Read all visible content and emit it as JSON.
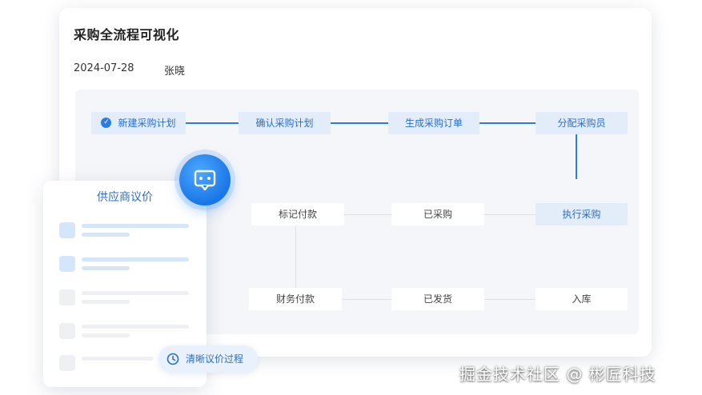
{
  "header": {
    "title": "采购全流程可视化",
    "date": "2024-07-28",
    "user": "张晓"
  },
  "flow": {
    "row1": [
      "新建采购计划",
      "确认采购计划",
      "生成采购订单",
      "分配采购员"
    ],
    "row2": [
      "标记付款",
      "已采购",
      "执行采购"
    ],
    "row3": [
      "财务付款",
      "已发货",
      "入库"
    ],
    "completed_step": "新建采购计划",
    "active_steps": [
      "新建采购计划",
      "确认采购计划",
      "生成采购订单",
      "分配采购员",
      "执行采购"
    ]
  },
  "supplier_panel": {
    "title": "供应商议价"
  },
  "clear_process": {
    "label": "清晰议价过程"
  },
  "watermark": "掘金技术社区 @ 彬匠科技",
  "icons": {
    "check": "check-circle-icon",
    "chat": "chat-bubble-icon",
    "clock": "clock-icon"
  },
  "colors": {
    "accent": "#2a7de1",
    "active_node_bg": "#e3edf9",
    "flow_bg": "#f4f6f9"
  }
}
